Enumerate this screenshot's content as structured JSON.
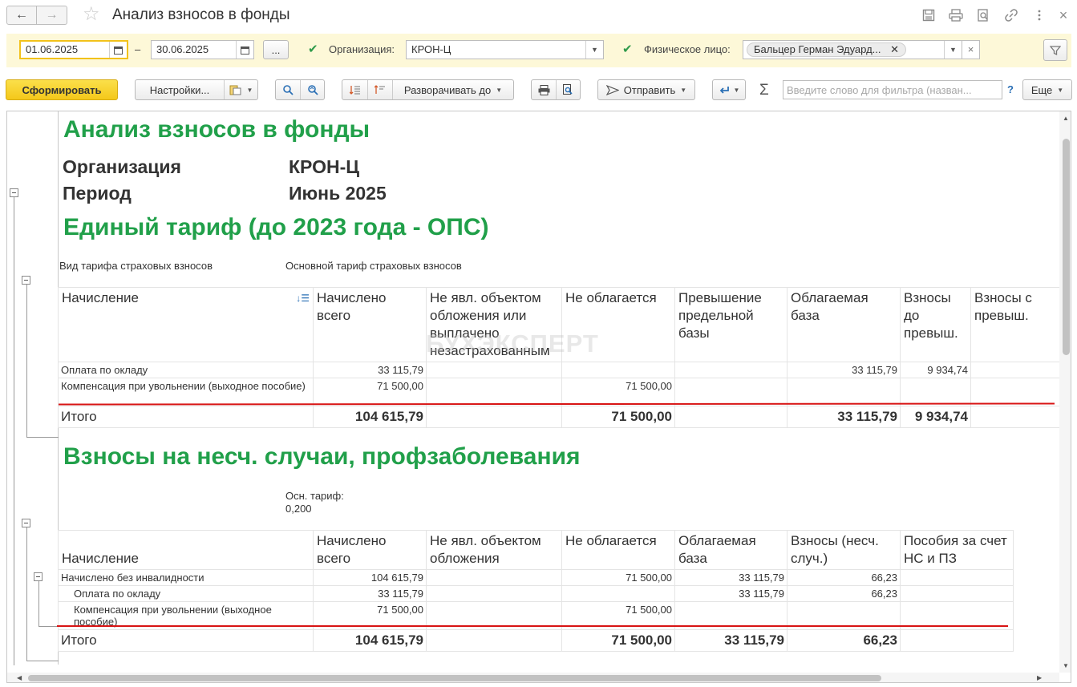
{
  "window": {
    "title": "Анализ взносов в фонды"
  },
  "filters": {
    "date_from": "01.06.2025",
    "date_to": "30.06.2025",
    "dash": "–",
    "more_label": "...",
    "org_label": "Организация:",
    "org_value": "КРОН-Ц",
    "person_label": "Физическое лицо:",
    "person_value": "Бальцер Герман Эдуард...",
    "clear_symbol": "×"
  },
  "toolbar": {
    "generate": "Сформировать",
    "settings": "Настройки...",
    "expand": "Разворачивать до",
    "send": "Отправить",
    "sigma": "Σ",
    "filter_placeholder": "Введите слово для фильтра (назван...",
    "help": "?",
    "more": "Еще"
  },
  "report": {
    "title": "Анализ взносов в фонды",
    "org_label": "Организация",
    "org_value": "КРОН-Ц",
    "period_label": "Период",
    "period_value": "Июнь 2025",
    "watermark": "БУХЭКСПЕРТ",
    "section1": {
      "title": "Единый тариф (до 2023 года - ОПС)",
      "tariff_label": "Вид тарифа страховых взносов",
      "tariff_value": "Основной тариф страховых взносов",
      "headers": [
        "Начисление",
        "Начислено всего",
        "Не явл. объектом обложения или выплачено незастрахованным",
        "Не облагается",
        "Превышение предельной базы",
        "Облагаемая база",
        "Взносы до превыш.",
        "Взносы с превыш."
      ],
      "sort_icon": "↓☰",
      "rows": [
        [
          "Оплата по окладу",
          "33 115,79",
          "",
          "",
          "",
          "33 115,79",
          "9 934,74",
          ""
        ],
        [
          "Компенсация при увольнении (выходное пособие)",
          "71 500,00",
          "",
          "71 500,00",
          "",
          "",
          "",
          ""
        ]
      ],
      "total": [
        "Итого",
        "104 615,79",
        "",
        "71 500,00",
        "",
        "33 115,79",
        "9 934,74",
        ""
      ]
    },
    "section2": {
      "title": "Взносы на несч. случаи, профзаболевания",
      "tariff_line1": "Осн. тариф:",
      "tariff_line2": "0,200",
      "headers": [
        "Начисление",
        "Начислено всего",
        "Не явл. объектом обложения",
        "Не облагается",
        "Облагаемая база",
        "Взносы (несч. случ.)",
        "Пособия за счет НС и ПЗ"
      ],
      "rows": [
        [
          "Начислено без инвалидности",
          "104 615,79",
          "",
          "71 500,00",
          "33 115,79",
          "66,23",
          ""
        ],
        [
          "Оплата по окладу",
          "33 115,79",
          "",
          "",
          "33 115,79",
          "66,23",
          ""
        ],
        [
          "Компенсация при увольнении (выходное пособие)",
          "71 500,00",
          "",
          "71 500,00",
          "",
          "",
          ""
        ]
      ],
      "total": [
        "Итого",
        "104 615,79",
        "",
        "71 500,00",
        "33 115,79",
        "66,23",
        ""
      ]
    }
  }
}
